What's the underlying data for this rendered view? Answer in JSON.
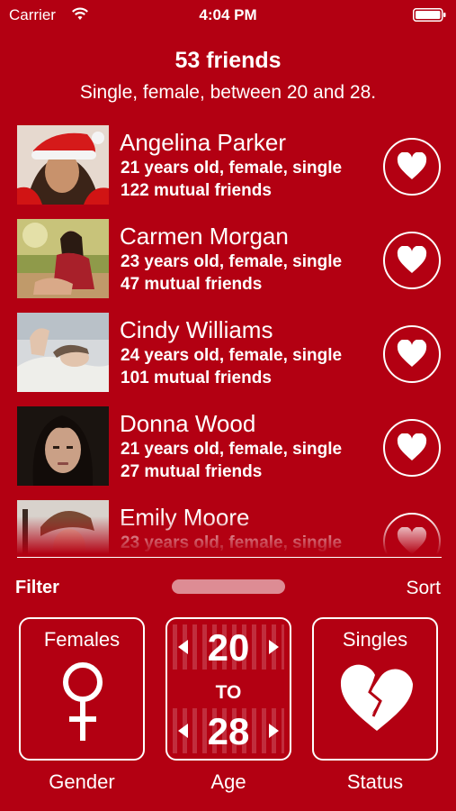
{
  "status_bar": {
    "carrier": "Carrier",
    "time": "4:04 PM"
  },
  "header": {
    "title": "53 friends",
    "subtitle": "Single, female, between 20 and 28."
  },
  "friends": [
    {
      "name": "Angelina Parker",
      "detail": "21 years old, female, single",
      "mutual": "122 mutual friends"
    },
    {
      "name": "Carmen Morgan",
      "detail": "23 years old, female, single",
      "mutual": "47 mutual friends"
    },
    {
      "name": "Cindy Williams",
      "detail": "24 years old, female, single",
      "mutual": "101 mutual friends"
    },
    {
      "name": "Donna Wood",
      "detail": "21 years old, female, single",
      "mutual": "27 mutual friends"
    },
    {
      "name": "Emily Moore",
      "detail": "23 years old, female, single",
      "mutual": ""
    }
  ],
  "filter_bar": {
    "filter_label": "Filter",
    "sort_label": "Sort"
  },
  "filters": {
    "gender": {
      "value": "Females",
      "caption": "Gender",
      "icon": "female-symbol-icon"
    },
    "age": {
      "from": "20",
      "to_label": "TO",
      "to": "28",
      "caption": "Age"
    },
    "status": {
      "value": "Singles",
      "caption": "Status",
      "icon": "broken-heart-icon"
    }
  },
  "colors": {
    "background": "#b30012",
    "foreground": "#ffffff"
  }
}
